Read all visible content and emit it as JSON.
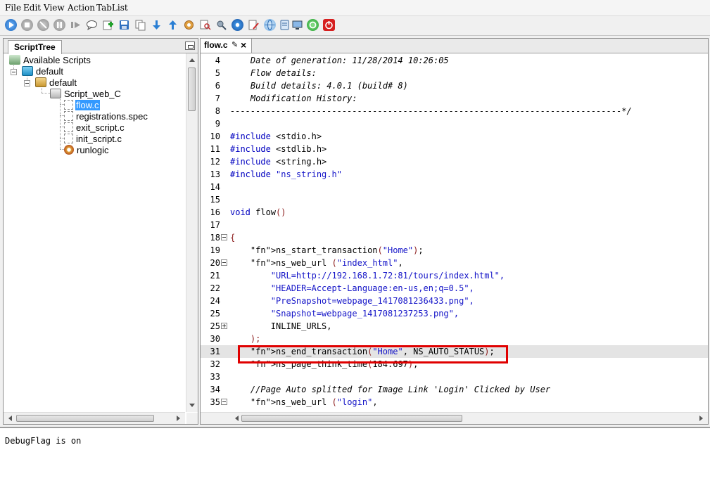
{
  "menu": [
    "File",
    "Edit",
    "View",
    "Action",
    "TabList"
  ],
  "toolbar": {
    "icons": [
      "play-icon",
      "stop-icon",
      "cancel-icon",
      "pause-icon",
      "step-icon",
      "comment-icon",
      "add-icon",
      "save-icon",
      "copy-icon",
      "download-icon",
      "upload-icon",
      "settings-icon",
      "search-icon",
      "tools-icon",
      "gear-icon",
      "edit-icon",
      "globe-icon",
      "document-icon",
      "monitor-icon",
      "refresh-icon",
      "power-icon"
    ],
    "colors": {
      "blue": "#1a73c7",
      "grey": "#9a9a9a",
      "green": "#22a02c",
      "red": "#d62020"
    }
  },
  "left_panel": {
    "tab": "ScriptTree",
    "tree": {
      "root": "Available Scripts",
      "level1": "default",
      "level2": "default",
      "script": "Script_web_C",
      "files": [
        "flow.c",
        "registrations.spec",
        "exit_script.c",
        "init_script.c",
        "runlogic"
      ],
      "selected": "flow.c"
    }
  },
  "editor": {
    "tab": "flow.c",
    "tab_marker": "✎",
    "close": "×",
    "lines": [
      {
        "n": "4",
        "text": "    Date of generation: 11/28/2014 10:26:05",
        "style": "cm"
      },
      {
        "n": "5",
        "text": "    Flow details:",
        "style": "cm"
      },
      {
        "n": "6",
        "text": "    Build details: 4.0.1 (build# 8)",
        "style": "cm"
      },
      {
        "n": "7",
        "text": "    Modification History:",
        "style": "cm"
      },
      {
        "n": "8",
        "text": "-----------------------------------------------------------------------------*/",
        "style": "cm"
      },
      {
        "n": "9",
        "text": "",
        "style": ""
      },
      {
        "n": "10",
        "text": "#include <stdio.h>",
        "style": "inc"
      },
      {
        "n": "11",
        "text": "#include <stdlib.h>",
        "style": "inc"
      },
      {
        "n": "12",
        "text": "#include <string.h>",
        "style": "inc"
      },
      {
        "n": "13",
        "text": "#include \"ns_string.h\"",
        "style": "incs"
      },
      {
        "n": "14",
        "text": "",
        "style": ""
      },
      {
        "n": "15",
        "text": "",
        "style": ""
      },
      {
        "n": "16",
        "text": "void flow()",
        "style": "void"
      },
      {
        "n": "17",
        "text": "",
        "style": ""
      },
      {
        "n": "18",
        "text": "{",
        "style": "fn",
        "fold": "minus"
      },
      {
        "n": "19",
        "text": "    ns_start_transaction(\"Home\");",
        "style": "call"
      },
      {
        "n": "20",
        "text": "    ns_web_url (\"index_html\",",
        "style": "call",
        "fold": "minus"
      },
      {
        "n": "21",
        "text": "        \"URL=http://192.168.1.72:81/tours/index.html\",",
        "style": "str"
      },
      {
        "n": "22",
        "text": "        \"HEADER=Accept-Language:en-us,en;q=0.5\",",
        "style": "str"
      },
      {
        "n": "24",
        "text": "        \"PreSnapshot=webpage_1417081236433.png\",",
        "style": "str"
      },
      {
        "n": "25",
        "text": "        \"Snapshot=webpage_1417081237253.png\",",
        "style": "str"
      },
      {
        "n": "25",
        "text": "        INLINE_URLS,",
        "style": "plain",
        "fold": "plus"
      },
      {
        "n": "30",
        "text": "    );",
        "style": "fn"
      },
      {
        "n": "31",
        "text": "    ns_end_transaction(\"Home\", NS_AUTO_STATUS);",
        "style": "call",
        "highlight": true
      },
      {
        "n": "32",
        "text": "    ns_page_think_time(184.697);",
        "style": "call"
      },
      {
        "n": "33",
        "text": "",
        "style": ""
      },
      {
        "n": "34",
        "text": "    //Page Auto splitted for Image Link 'Login' Clicked by User",
        "style": "cm"
      },
      {
        "n": "35",
        "text": "    ns_web_url (\"login\",",
        "style": "call",
        "fold": "minus"
      }
    ]
  },
  "console": {
    "message": "DebugFlag is on"
  }
}
